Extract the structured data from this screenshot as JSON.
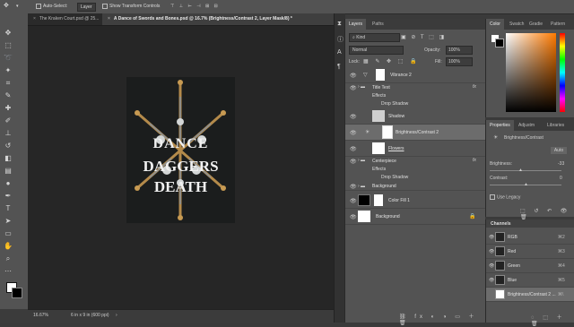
{
  "options_bar": {
    "auto_select_label": "Auto-Select:",
    "auto_select_value": "Layer",
    "transform_label": "Show Transform Controls"
  },
  "tabs": [
    {
      "label": "The Kraken Court.psd @ 25..."
    },
    {
      "label": "A Dance of Swords and Bones.psd @ 16.7% (Brightness/Contrast 2, Layer Mask/8) *"
    }
  ],
  "document": {
    "line1": "DANCE",
    "line2": "DAGGERS",
    "line3": "DEATH"
  },
  "status": {
    "zoom": "16.67%",
    "doc_info": "6 in x 9 in (600 ppi)"
  },
  "layers_panel": {
    "tabs": [
      "Layers",
      "Paths"
    ],
    "filter": "Kind",
    "blend_mode": "Normal",
    "opacity_label": "Opacity:",
    "opacity_value": "100%",
    "lock_label": "Lock:",
    "fill_label": "Fill:",
    "fill_value": "100%",
    "layers": [
      {
        "name": "Vibrance 2"
      },
      {
        "name": "Title Text",
        "fx": "fx"
      },
      {
        "name": "Effects"
      },
      {
        "name": "Drop Shadow"
      },
      {
        "name": "Shadow"
      },
      {
        "name": "Brightness/Contrast 2"
      },
      {
        "name": "Flowers"
      },
      {
        "name": "Centerpiece",
        "fx": "fx"
      },
      {
        "name": "Effects"
      },
      {
        "name": "Drop Shadow"
      },
      {
        "name": "Background"
      },
      {
        "name": "Color Fill 1"
      },
      {
        "name": "Background"
      }
    ]
  },
  "color_panel": {
    "tabs": [
      "Color",
      "Swatch",
      "Gradie",
      "Pattern"
    ],
    "accent": "#ff7a00"
  },
  "properties_panel": {
    "tabs": [
      "Properties",
      "Adjustm",
      "Libraries"
    ],
    "title": "Brightness/Contrast",
    "auto_label": "Auto",
    "brightness_label": "Brightness:",
    "brightness_value": "-33",
    "contrast_label": "Contrast:",
    "contrast_value": "0",
    "legacy_label": "Use Legacy"
  },
  "channels_panel": {
    "title": "Channels",
    "channels": [
      {
        "name": "RGB",
        "key": "⌘2"
      },
      {
        "name": "Red",
        "key": "⌘3"
      },
      {
        "name": "Green",
        "key": "⌘4"
      },
      {
        "name": "Blue",
        "key": "⌘5"
      },
      {
        "name": "Brightness/Contrast 2 ...",
        "key": "⌘\\"
      }
    ]
  }
}
